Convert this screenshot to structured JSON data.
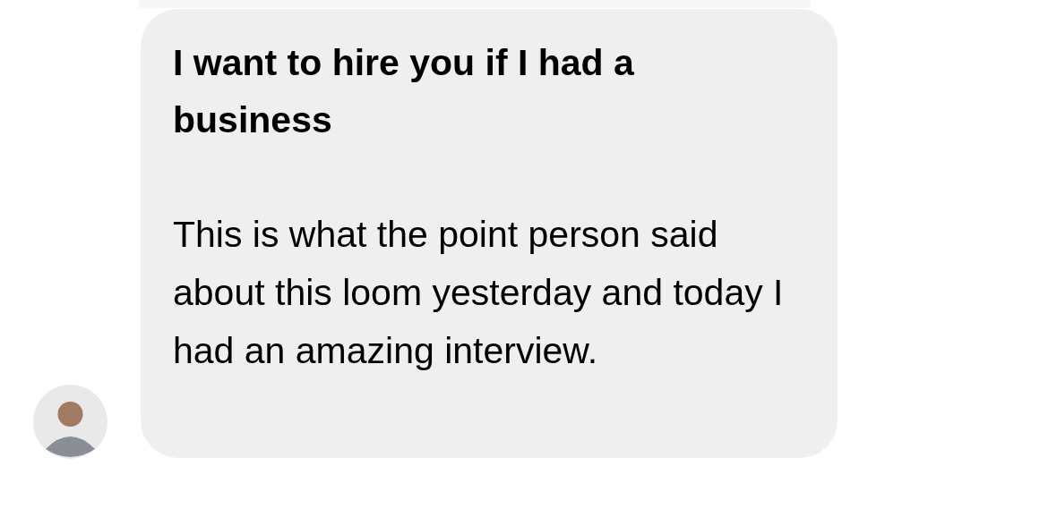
{
  "message": {
    "title": "I want to hire you if I had a business",
    "body": "This is what the point person said about this loom yesterday and today I had an amazing interview."
  }
}
